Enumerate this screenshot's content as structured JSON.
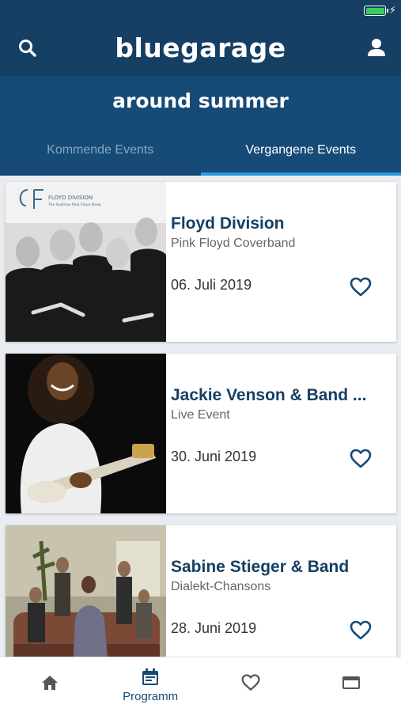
{
  "colors": {
    "primary": "#153f63",
    "secondary": "#164b77",
    "tab_indicator": "#2a9ae0",
    "battery": "#35d05a"
  },
  "status_bar": {
    "battery_level": 1.0,
    "charging_icon": "bolt-icon"
  },
  "app_bar": {
    "brand": "bluegarage",
    "search_icon": "search-icon",
    "account_icon": "user-icon"
  },
  "venue_title": "around summer",
  "tabs": [
    {
      "label": "Kommende Events",
      "active": false
    },
    {
      "label": "Vergangene Events",
      "active": true
    }
  ],
  "events": [
    {
      "title": "Floyd Division",
      "subtitle": "Pink Floyd Coverband",
      "date": "06. Juli 2019",
      "image_logo": "FLOYD DIVISION",
      "image_tagline": "The Austrian Pink Floyd Show",
      "favorite_icon": "heart-outline-icon"
    },
    {
      "title": "Jackie Venson & Band ...",
      "subtitle": "Live Event",
      "date": "30. Juni 2019",
      "favorite_icon": "heart-outline-icon"
    },
    {
      "title": "Sabine Stieger & Band",
      "subtitle": "Dialekt-Chansons",
      "date": "28. Juni 2019",
      "favorite_icon": "heart-outline-icon"
    }
  ],
  "bottom_nav": [
    {
      "icon": "home-icon",
      "label": ""
    },
    {
      "icon": "calendar-icon",
      "label": "Programm",
      "active": true
    },
    {
      "icon": "heart-outline-icon",
      "label": ""
    },
    {
      "icon": "card-icon",
      "label": ""
    }
  ]
}
